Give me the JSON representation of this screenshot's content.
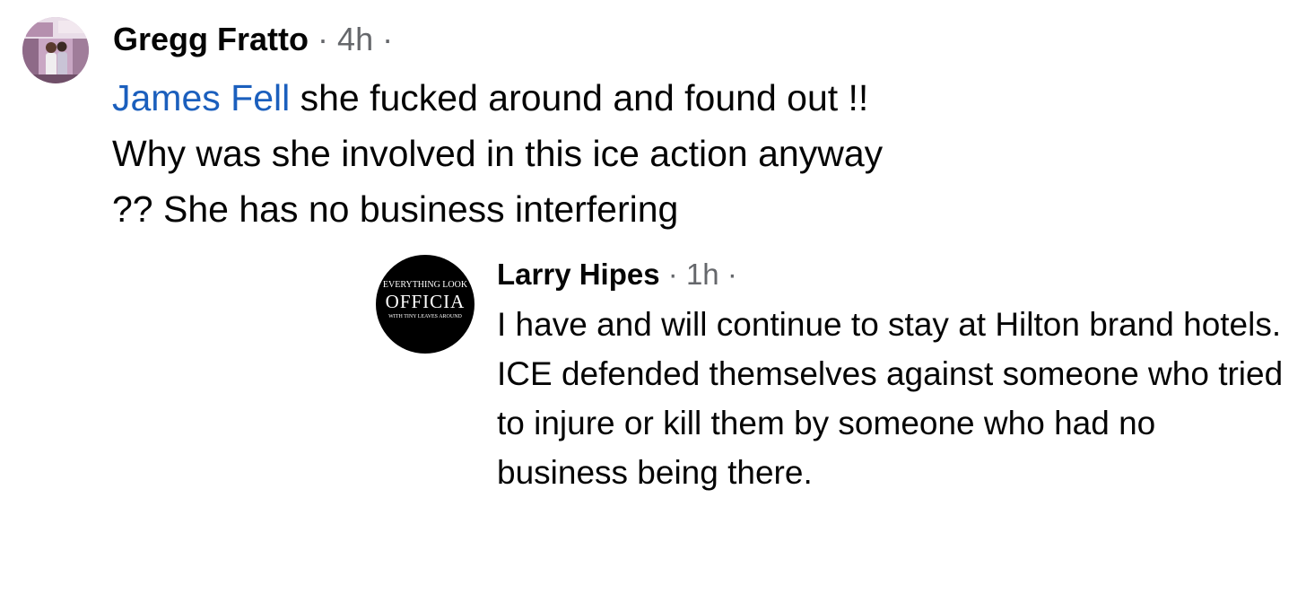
{
  "comments": [
    {
      "author": "Gregg Fratto",
      "time": "4h",
      "mention": "James Fell",
      "text": " she fucked around and found out !! Why was she involved in this ice action anyway ?? She has no business interfering"
    },
    {
      "author": "Larry Hipes",
      "time": "1h",
      "avatar_logo": {
        "top": "EVERYTHING LOOK",
        "middle": "OFFICIA",
        "bottom": "WITH TINY LEAVES AROUND"
      },
      "lines": [
        "I have and will continue to stay at Hilton brand hotels.",
        "ICE defended themselves against someone who tried to injure or kill them by someone who had no business being there."
      ]
    }
  ],
  "separator": "·",
  "colors": {
    "mention": "#1b5fbd",
    "meta": "#65676b",
    "text": "#050505"
  }
}
